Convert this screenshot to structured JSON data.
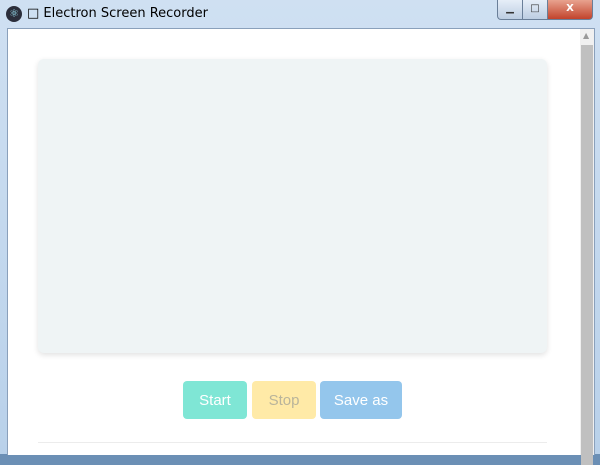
{
  "window": {
    "title": "□ Electron Screen Recorder",
    "controls": {
      "minimize": "▁",
      "maximize": "□",
      "close": "X"
    }
  },
  "buttons": {
    "start": "Start",
    "stop": "Stop",
    "save": "Save as"
  },
  "colors": {
    "start": "#7fe6d5",
    "stop": "#ffeaa7",
    "save": "#94c6ec"
  }
}
